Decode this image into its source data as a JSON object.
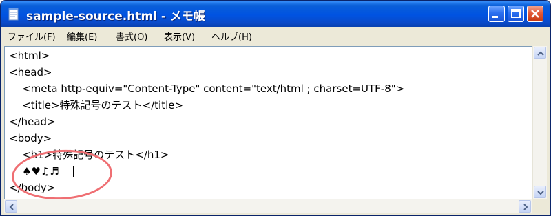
{
  "window": {
    "title": "sample-source.html - メモ帳",
    "app_icon": "notepad-icon",
    "buttons": [
      "minimize-icon",
      "maximize-icon",
      "close-icon"
    ]
  },
  "menu": {
    "items": [
      "ファイル(F)",
      "編集(E)",
      "書式(O)",
      "表示(V)",
      "ヘルプ(H)"
    ]
  },
  "editor": {
    "lines": [
      "<html>",
      "<head>",
      "    <meta http-equiv=\"Content-Type\" content=\"text/html ; charset=UTF-8\">",
      "    <title>特殊記号のテスト</title>",
      "</head>",
      "<body>",
      "    <h1>特殊記号のテスト</h1>",
      "    ♠♥♫♬",
      "</body>"
    ]
  },
  "annotation": {
    "color": "#ef6f73"
  },
  "colors": {
    "titlebar": "#0053e1",
    "menubar": "#ece9d8",
    "editor_background": "#ffffff"
  }
}
